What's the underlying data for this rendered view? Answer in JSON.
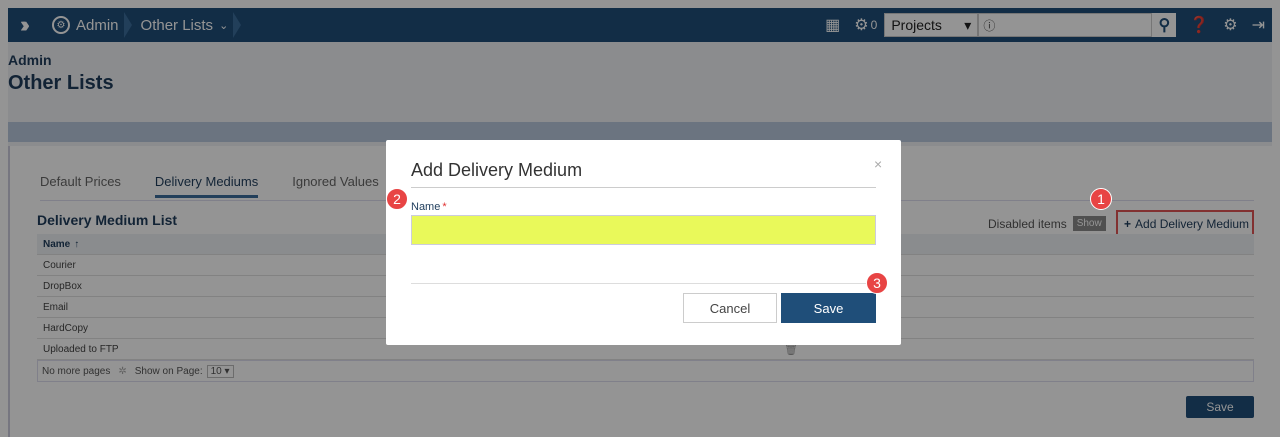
{
  "topbar": {
    "breadcrumbs": [
      "Admin",
      "Other Lists"
    ],
    "tasks_count": "0",
    "projects_select": "Projects",
    "search_placeholder": "ⓘ"
  },
  "page": {
    "section": "Admin",
    "title": "Other Lists"
  },
  "tabs": [
    "Default Prices",
    "Delivery Mediums",
    "Ignored Values"
  ],
  "list": {
    "title": "Delivery Medium List",
    "disabled_label": "Disabled items",
    "show_label": "Show",
    "add_label": "Add Delivery Medium",
    "column_name": "Name",
    "rows": [
      "Courier",
      "DropBox",
      "Email",
      "HardCopy",
      "Uploaded to FTP"
    ],
    "footer_pages": "No more pages",
    "footer_show": "Show on Page:",
    "page_size": "10",
    "save_label": "Save"
  },
  "modal": {
    "title": "Add Delivery Medium",
    "close": "×",
    "name_label": "Name",
    "required_mark": "*",
    "name_value": "",
    "cancel_label": "Cancel",
    "save_label": "Save"
  },
  "callouts": [
    "1",
    "2",
    "3"
  ],
  "colors": {
    "brand": "#1f4e79",
    "input_highlight": "#e9f95a",
    "callout": "#e84444"
  }
}
